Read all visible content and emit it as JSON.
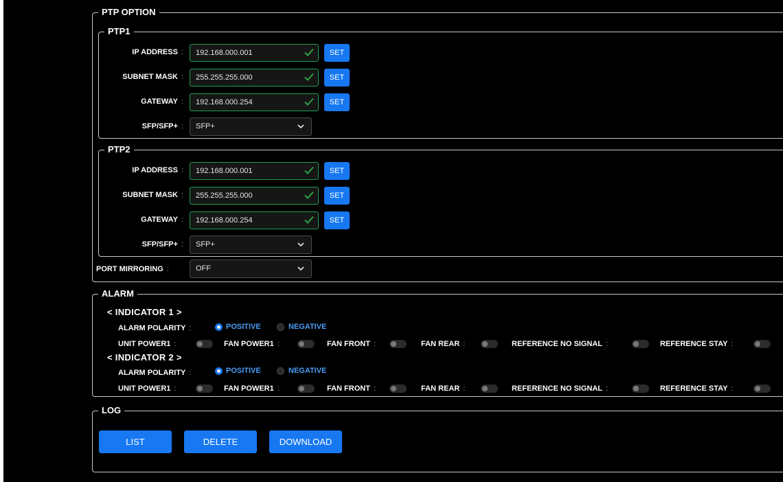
{
  "ptp_option": {
    "legend": "PTP OPTION",
    "ptp1": {
      "legend": "PTP1",
      "ip_label": "IP ADDRESS",
      "ip_value": "192.168.000.001",
      "subnet_label": "SUBNET MASK",
      "subnet_value": "255.255.255.000",
      "gateway_label": "GATEWAY",
      "gateway_value": "192.168.000.254",
      "sfp_label": "SFP/SFP+",
      "sfp_value": "SFP+",
      "set_label": "SET"
    },
    "ptp2": {
      "legend": "PTP2",
      "ip_label": "IP ADDRESS",
      "ip_value": "192.168.000.001",
      "subnet_label": "SUBNET MASK",
      "subnet_value": "255.255.255.000",
      "gateway_label": "GATEWAY",
      "gateway_value": "192.168.000.254",
      "sfp_label": "SFP/SFP+",
      "sfp_value": "SFP+",
      "set_label": "SET"
    },
    "port_mirroring_label": "PORT MIRRORING",
    "port_mirroring_value": "OFF"
  },
  "alarm": {
    "legend": "ALARM",
    "indicator1": {
      "title": "< INDICATOR 1 >",
      "polarity_label": "ALARM POLARITY",
      "positive_label": "POSITIVE",
      "negative_label": "NEGATIVE",
      "selected": "POSITIVE",
      "toggles": [
        "UNIT POWER1",
        "FAN POWER1",
        "FAN FRONT",
        "FAN REAR",
        "REFERENCE NO SIGNAL",
        "REFERENCE STAY"
      ]
    },
    "indicator2": {
      "title": "< INDICATOR 2 >",
      "polarity_label": "ALARM POLARITY",
      "positive_label": "POSITIVE",
      "negative_label": "NEGATIVE",
      "selected": "POSITIVE",
      "toggles": [
        "UNIT POWER1",
        "FAN POWER1",
        "FAN FRONT",
        "FAN REAR",
        "REFERENCE NO SIGNAL",
        "REFERENCE STAY"
      ]
    },
    "colors": {
      "accent": "#1778f2",
      "valid_border": "#1f9d55",
      "valid_check": "#2ea043"
    }
  },
  "log": {
    "legend": "LOG",
    "list_label": "LIST",
    "delete_label": "DELETE",
    "download_label": "DOWNLOAD"
  }
}
